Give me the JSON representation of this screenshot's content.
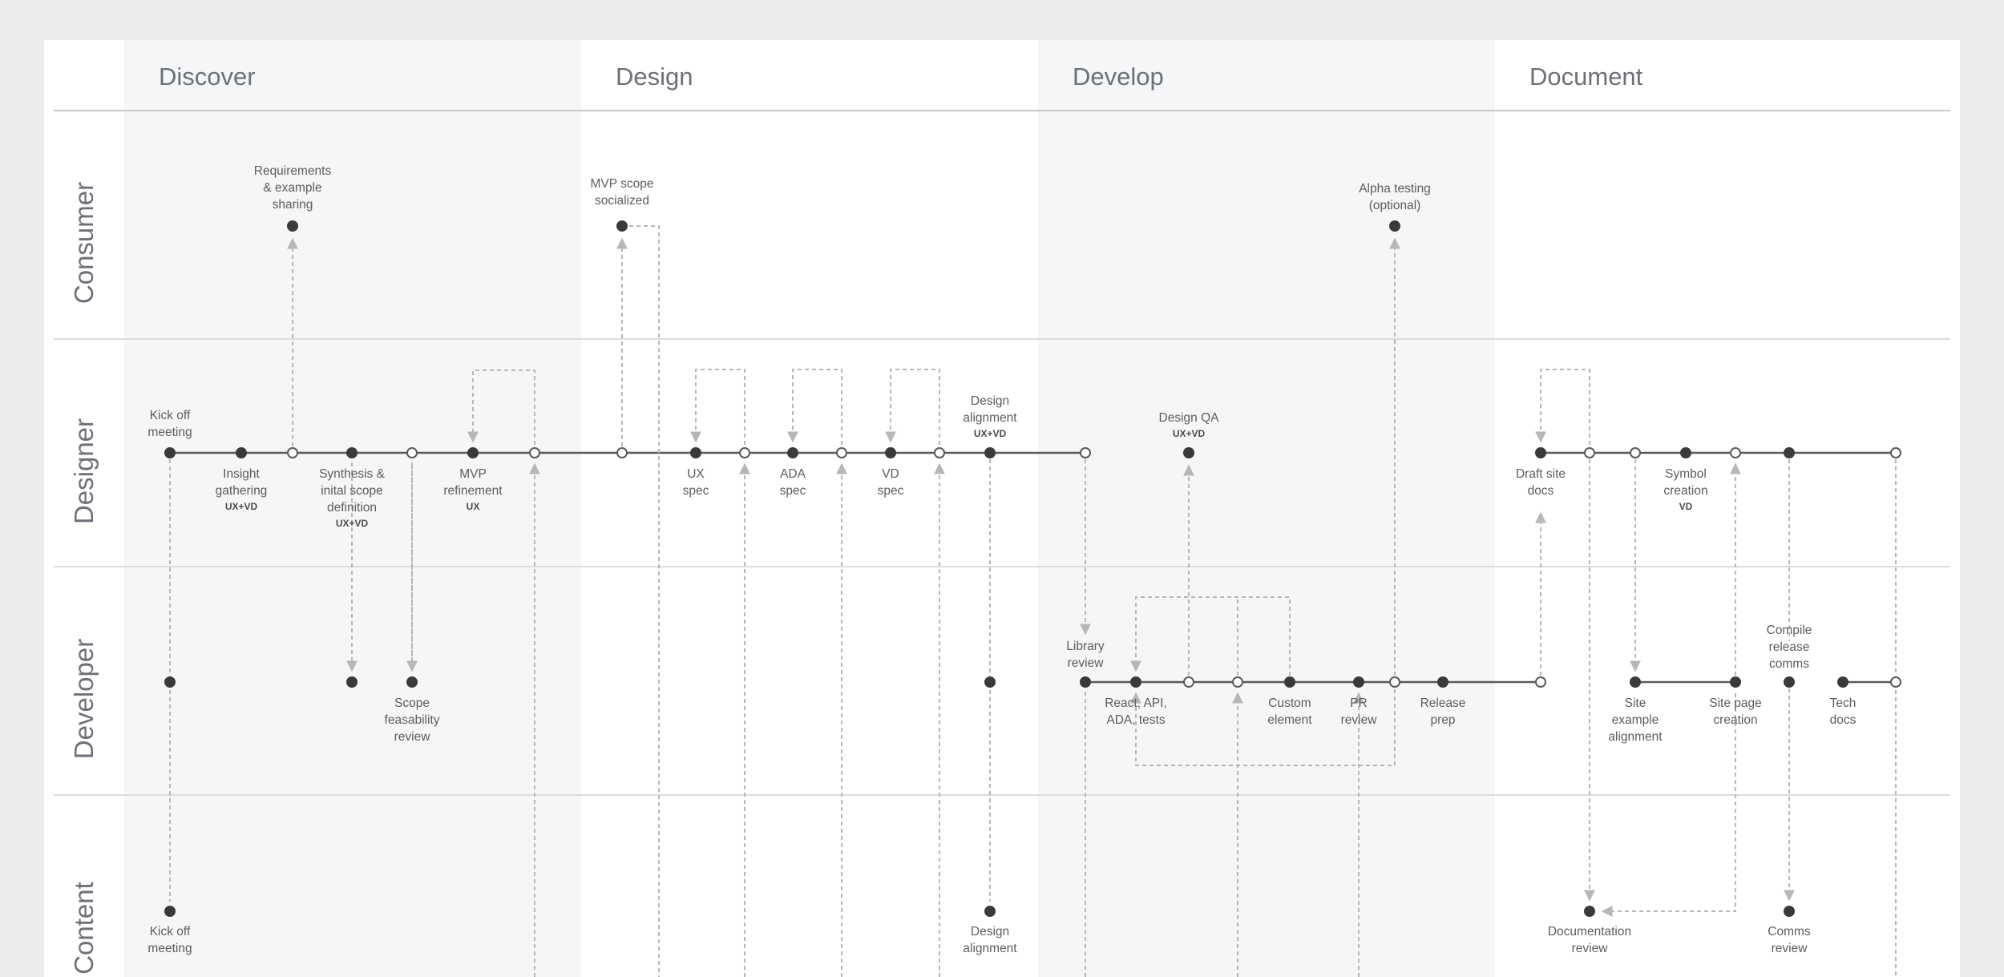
{
  "phases": [
    "Discover",
    "Design",
    "Develop",
    "Document"
  ],
  "lanes": [
    "Consumer",
    "Designer",
    "Developer",
    "Content"
  ],
  "colors": {
    "page": "#ececec",
    "board": "#ffffff",
    "shade": "#f5f6f8",
    "track": "#5a5a5a",
    "dot": "#3a3a3a",
    "connector": "#b7b7b7",
    "text": "#5c5c5c"
  },
  "labels": {
    "requirements": [
      "Requirements",
      "& example",
      "sharing"
    ],
    "mvp_scope": [
      "MVP scope",
      "socialized"
    ],
    "alpha_testing": [
      "Alpha testing",
      "(optional)"
    ],
    "kickoff_designer": [
      "Kick off",
      "meeting"
    ],
    "insight": [
      "Insight",
      "gathering"
    ],
    "insight_tag": "UX+VD",
    "synthesis": [
      "Synthesis &",
      "inital scope",
      "definition"
    ],
    "synthesis_tag": "UX+VD",
    "mvp_refinement": [
      "MVP",
      "refinement"
    ],
    "mvp_refinement_tag": "UX",
    "ux_spec": [
      "UX",
      "spec"
    ],
    "ada_spec": [
      "ADA",
      "spec"
    ],
    "vd_spec": [
      "VD",
      "spec"
    ],
    "design_alignment_designer": [
      "Design",
      "alignment"
    ],
    "design_alignment_tag": "UX+VD",
    "design_qa": [
      "Design QA"
    ],
    "design_qa_tag": "UX+VD",
    "draft_site_docs": [
      "Draft site",
      "docs"
    ],
    "symbol_creation": [
      "Symbol",
      "creation"
    ],
    "symbol_creation_tag": "VD",
    "scope_feasability": [
      "Scope",
      "feasability",
      "review"
    ],
    "library_review": [
      "Library",
      "review"
    ],
    "react_api": [
      "React, API,",
      "ADA, tests"
    ],
    "custom_element": [
      "Custom",
      "element"
    ],
    "pr_review": [
      "PR",
      "review"
    ],
    "release_prep": [
      "Release",
      "prep"
    ],
    "site_example": [
      "Site",
      "example",
      "alignment"
    ],
    "site_page": [
      "Site page",
      "creation"
    ],
    "compile_release": [
      "Compile",
      "release",
      "comms"
    ],
    "tech_docs": [
      "Tech",
      "docs"
    ],
    "kickoff_content": [
      "Kick off",
      "meeting"
    ],
    "design_alignment_content": [
      "Design",
      "alignment"
    ],
    "documentation_review": [
      "Documentation",
      "review"
    ],
    "comms_review": [
      "Comms",
      "review"
    ]
  }
}
